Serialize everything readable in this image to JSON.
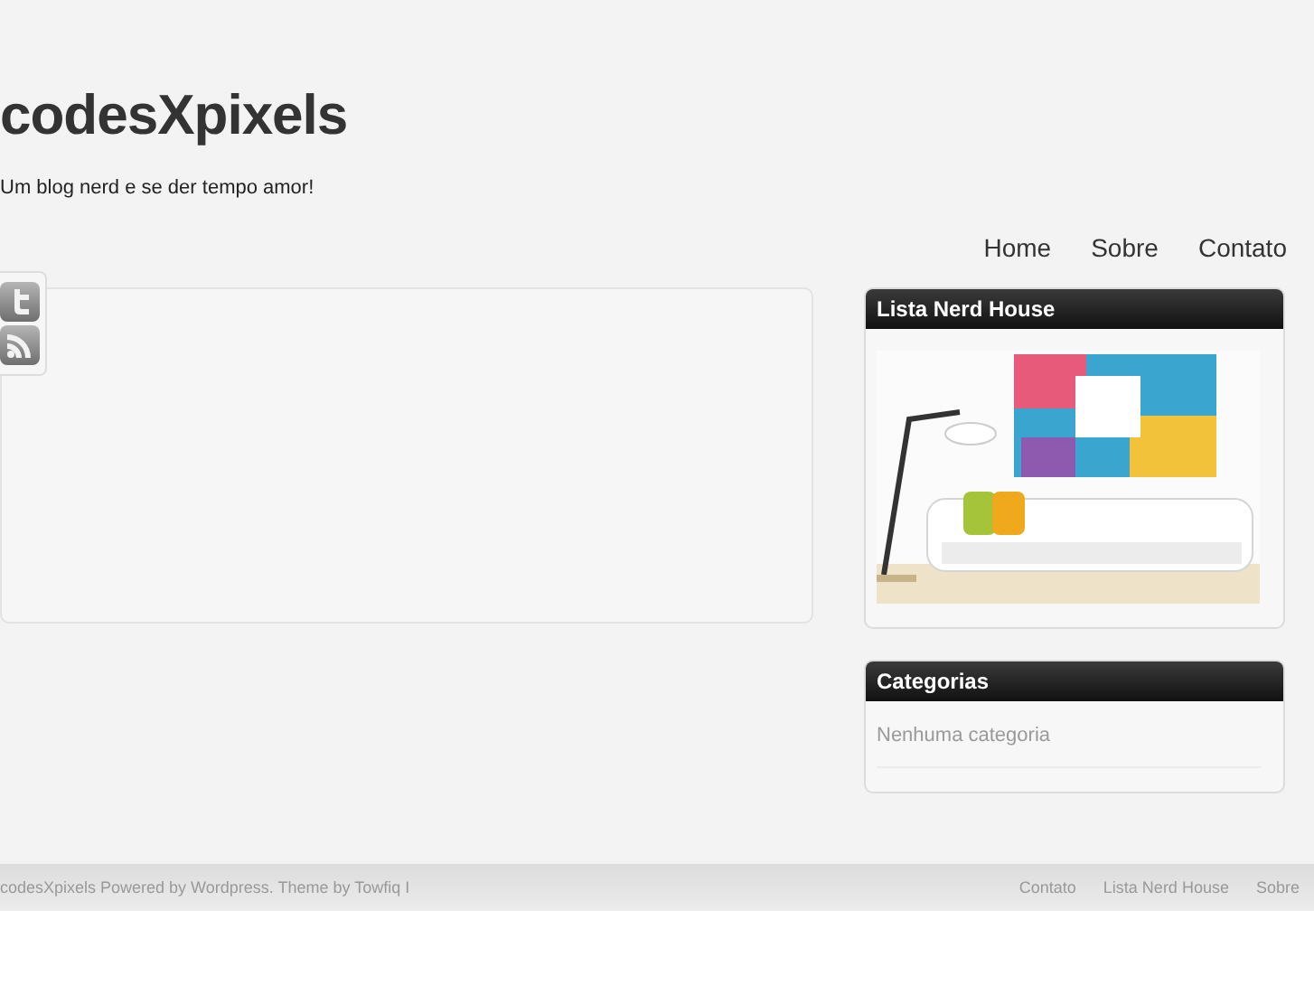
{
  "header": {
    "title": "codesXpixels",
    "tagline": "Um blog nerd e se der tempo amor!"
  },
  "nav": [
    "Home",
    "Sobre",
    "Contato"
  ],
  "social": [
    {
      "kind": "twitter"
    },
    {
      "kind": "rss"
    }
  ],
  "sidebar": [
    {
      "title": "Lista Nerd House",
      "kind": "picture"
    },
    {
      "title": "Categorias",
      "kind": "list",
      "items": [
        "Nenhuma categoria"
      ]
    }
  ],
  "footer": {
    "credit": "codesXpixels Powered by Wordpress. Theme by Towfiq I",
    "links": [
      "Contato",
      "Lista Nerd House",
      "Sobre"
    ]
  }
}
